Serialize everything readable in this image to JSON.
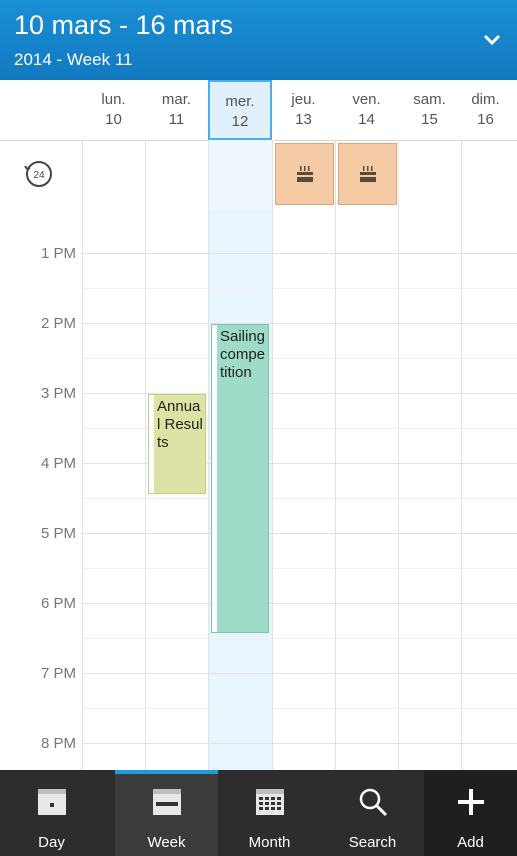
{
  "header": {
    "title": "10 mars - 16 mars",
    "subtitle": "2014 - Week 11"
  },
  "days": [
    {
      "name": "lun.",
      "date": "10"
    },
    {
      "name": "mar.",
      "date": "11"
    },
    {
      "name": "mer.",
      "date": "12"
    },
    {
      "name": "jeu.",
      "date": "13"
    },
    {
      "name": "ven.",
      "date": "14"
    },
    {
      "name": "sam.",
      "date": "15"
    },
    {
      "name": "dim.",
      "date": "16"
    }
  ],
  "hours": [
    "1 PM",
    "2 PM",
    "3 PM",
    "4 PM",
    "5 PM",
    "6 PM",
    "7 PM",
    "8 PM"
  ],
  "events": {
    "annual": "Annual Results",
    "sailing": "Sailing competition"
  },
  "tabs": [
    {
      "label": "Day"
    },
    {
      "label": "Week"
    },
    {
      "label": "Month"
    },
    {
      "label": "Search"
    },
    {
      "label": "Add"
    }
  ],
  "colors": {
    "header": "#1a8fd6",
    "today": "#dff0fb",
    "birthday": "#f5cba6",
    "annual_event": "#dde3a4",
    "sailing_event": "#9fdcc8",
    "tab_indicator": "#1b9be0"
  },
  "icons": {
    "dropdown": "chevron-down-icon",
    "all_day": "24-hour-icon",
    "birthday": "cake-icon"
  }
}
